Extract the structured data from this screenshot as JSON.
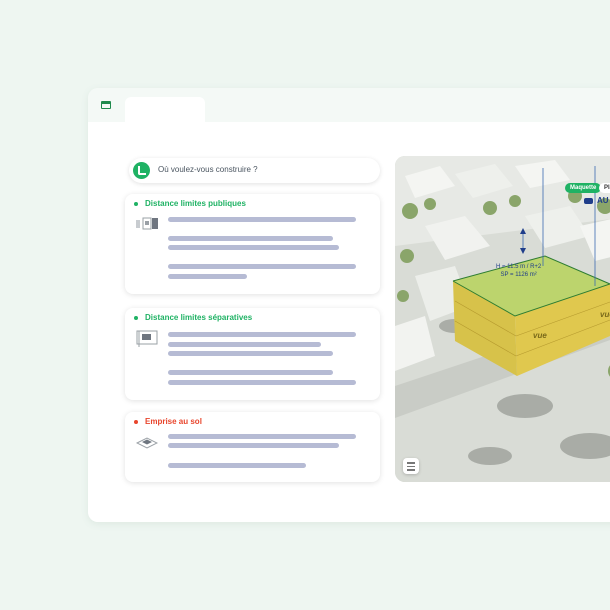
{
  "search": {
    "placeholder_text": "Où voulez-vous construire ?"
  },
  "cards": [
    {
      "title": "Distance limites publiques",
      "color": "#1fb264"
    },
    {
      "title": "Distance limites séparatives",
      "color": "#1fb264"
    },
    {
      "title": "Emprise au sol",
      "color": "#e8452c"
    }
  ],
  "map": {
    "height_label": "H = 11.5 m / R+2",
    "surface_label": "SP = 1126 m²",
    "tag_maquette": "Maquette",
    "tag_plan": "Plan",
    "tag_au": "AU",
    "vue_label": "vue",
    "icons": [
      "car-icon",
      "menu-icon"
    ]
  },
  "colors": {
    "accent": "#1fb264",
    "warning": "#e8452c",
    "text_bar": "#b6bbd4",
    "volume": "#c9d64a"
  }
}
